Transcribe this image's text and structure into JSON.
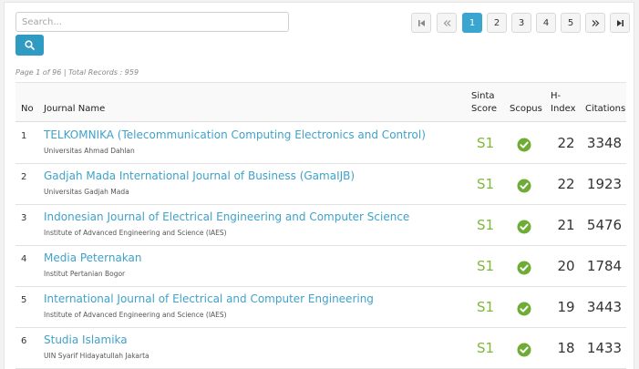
{
  "search": {
    "placeholder": "Search...",
    "value": ""
  },
  "pagination": {
    "first_icon": "first-page-icon",
    "prev_icon": "prev-page-icon",
    "pages": [
      "1",
      "2",
      "3",
      "4",
      "5"
    ],
    "active_page": "1",
    "next_icon": "next-page-icon",
    "last_icon": "last-page-icon"
  },
  "page_info": "Page 1 of 96 | Total Records : 959",
  "table": {
    "headers": {
      "no": "No",
      "journal_name": "Journal Name",
      "sinta_line1": "Sinta",
      "sinta_line2": "Score",
      "scopus": "Scopus",
      "h_line1": "H-",
      "h_line2": "Index",
      "citations": "Citations"
    },
    "rows": [
      {
        "no": "1",
        "name": "TELKOMNIKA (Telecommunication Computing Electronics and Control)",
        "institution": "Universitas Ahmad Dahlan",
        "sinta": "S1",
        "scopus": true,
        "h_index": "22",
        "citations": "3348"
      },
      {
        "no": "2",
        "name": "Gadjah Mada International Journal of Business (GamaIJB)",
        "institution": "Universitas Gadjah Mada",
        "sinta": "S1",
        "scopus": true,
        "h_index": "22",
        "citations": "1923"
      },
      {
        "no": "3",
        "name": "Indonesian Journal of Electrical Engineering and Computer Science",
        "institution": "Institute of Advanced Engineering and Science (IAES)",
        "sinta": "S1",
        "scopus": true,
        "h_index": "21",
        "citations": "5476"
      },
      {
        "no": "4",
        "name": "Media Peternakan",
        "institution": "Institut Pertanian Bogor",
        "sinta": "S1",
        "scopus": true,
        "h_index": "20",
        "citations": "1784"
      },
      {
        "no": "5",
        "name": "International Journal of Electrical and Computer Engineering",
        "institution": "Institute of Advanced Engineering and Science (IAES)",
        "sinta": "S1",
        "scopus": true,
        "h_index": "19",
        "citations": "3443"
      },
      {
        "no": "6",
        "name": "Studia Islamika",
        "institution": "UIN Syarif Hidayatullah Jakarta",
        "sinta": "S1",
        "scopus": true,
        "h_index": "18",
        "citations": "1433"
      }
    ]
  },
  "colors": {
    "accent": "#3aa6cf",
    "link": "#3fa2c8",
    "sinta_green": "#80b83a",
    "scopus_check": "#6fac36"
  }
}
